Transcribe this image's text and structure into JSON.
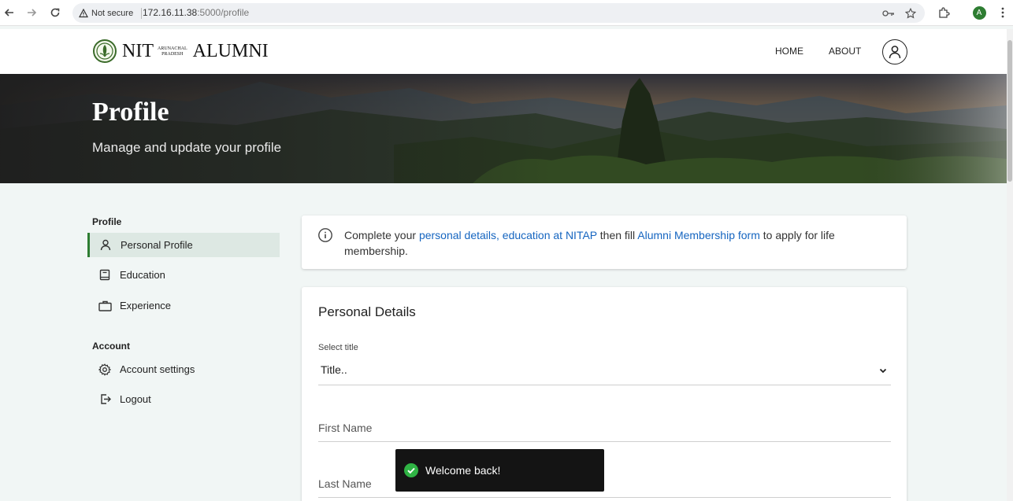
{
  "browser": {
    "security_label": "Not secure",
    "url_host": "172.16.11.38",
    "url_path": ":5000/profile",
    "profile_initial": "A"
  },
  "header": {
    "logo_nit": "NIT",
    "logo_place_line1": "ARUNACHAL",
    "logo_place_line2": "PRADESH",
    "logo_alumni": "ALUMNI",
    "nav": [
      "HOME",
      "ABOUT"
    ]
  },
  "hero": {
    "title": "Profile",
    "subtitle": "Manage and update your profile"
  },
  "sidebar": {
    "profile_heading": "Profile",
    "profile_items": [
      {
        "label": "Personal Profile",
        "icon": "person-icon"
      },
      {
        "label": "Education",
        "icon": "book-icon"
      },
      {
        "label": "Experience",
        "icon": "briefcase-icon"
      }
    ],
    "account_heading": "Account",
    "account_items": [
      {
        "label": "Account settings",
        "icon": "gear-icon"
      },
      {
        "label": "Logout",
        "icon": "logout-icon"
      }
    ]
  },
  "notice": {
    "text_1": "Complete your ",
    "link_1": "personal details, education at NITAP",
    "text_2": " then fill ",
    "link_2": "Alumni Membership form",
    "text_3": " to apply for life membership."
  },
  "form": {
    "title": "Personal Details",
    "title_select_label": "Select title",
    "title_select_value": "Title..",
    "first_name_placeholder": "First Name",
    "last_name_placeholder": "Last Name"
  },
  "toast": {
    "message": "Welcome back!"
  },
  "colors": {
    "accent_green": "#2e7d32",
    "link_blue": "#1565c0",
    "page_bg": "#f1f6f5"
  }
}
